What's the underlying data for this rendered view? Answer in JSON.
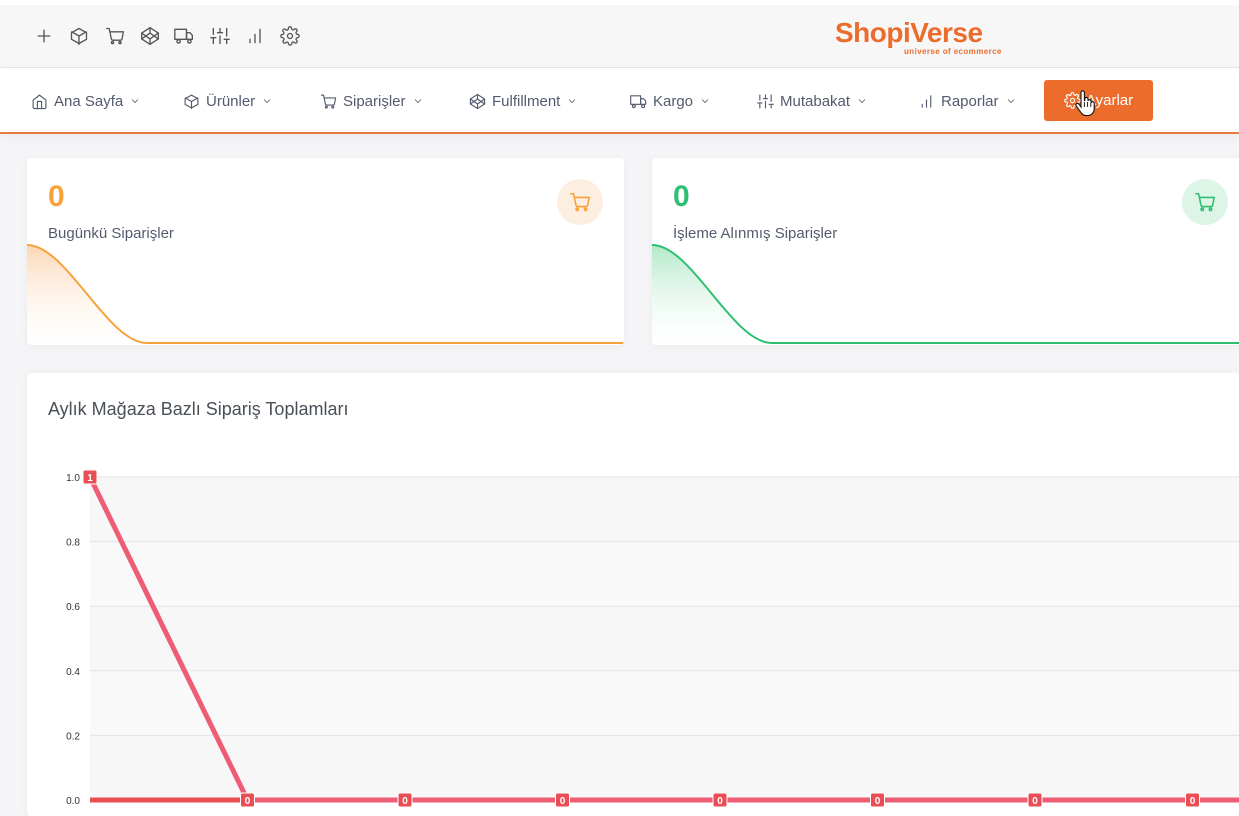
{
  "toolbar": {
    "icons": [
      "plus-icon",
      "box-icon",
      "cart-icon",
      "codepen-icon",
      "truck-icon",
      "sliders-icon",
      "bar-chart-icon",
      "gear-icon"
    ]
  },
  "brand": {
    "name": "ShopiVerse",
    "tagline": "universe of ecommerce",
    "color": "#ec6c2c"
  },
  "nav": {
    "items": [
      {
        "label": "Ana Sayfa",
        "icon": "home-icon"
      },
      {
        "label": "Ürünler",
        "icon": "box-icon"
      },
      {
        "label": "Siparişler",
        "icon": "cart-icon"
      },
      {
        "label": "Fulfillment",
        "icon": "codepen-icon"
      },
      {
        "label": "Kargo",
        "icon": "truck-icon"
      },
      {
        "label": "Mutabakat",
        "icon": "sliders-icon"
      },
      {
        "label": "Raporlar",
        "icon": "bar-chart-icon"
      }
    ],
    "active": {
      "label": "Ayarlar",
      "icon": "gear-icon"
    }
  },
  "stats": [
    {
      "value": "0",
      "label": "Bugünkü Siparişler",
      "color": "#f7a13a",
      "icon": "cart-icon"
    },
    {
      "value": "0",
      "label": "İşleme Alınmış Siparişler",
      "color": "#2fbf71",
      "icon": "cart-icon"
    }
  ],
  "chart": {
    "title": "Aylık Mağaza Bazlı Sipariş Toplamları"
  },
  "chart_data": {
    "type": "line",
    "title": "Aylık Mağaza Bazlı Sipariş Toplamları",
    "ylim": [
      0,
      1
    ],
    "yticks": [
      "1.0",
      "0.8",
      "0.6",
      "0.4",
      "0.2",
      "0.0"
    ],
    "grid": true,
    "series": [
      {
        "color": "#f05c74",
        "values": [
          1,
          0,
          0,
          0,
          0,
          0,
          0,
          0,
          0
        ]
      },
      {
        "color": "#ea4e55",
        "values": [
          0,
          0,
          0,
          0,
          0,
          0,
          0,
          0,
          0
        ]
      }
    ],
    "data_labels": [
      "1",
      "0",
      "0",
      "0",
      "0",
      "0",
      "0",
      "0"
    ]
  }
}
